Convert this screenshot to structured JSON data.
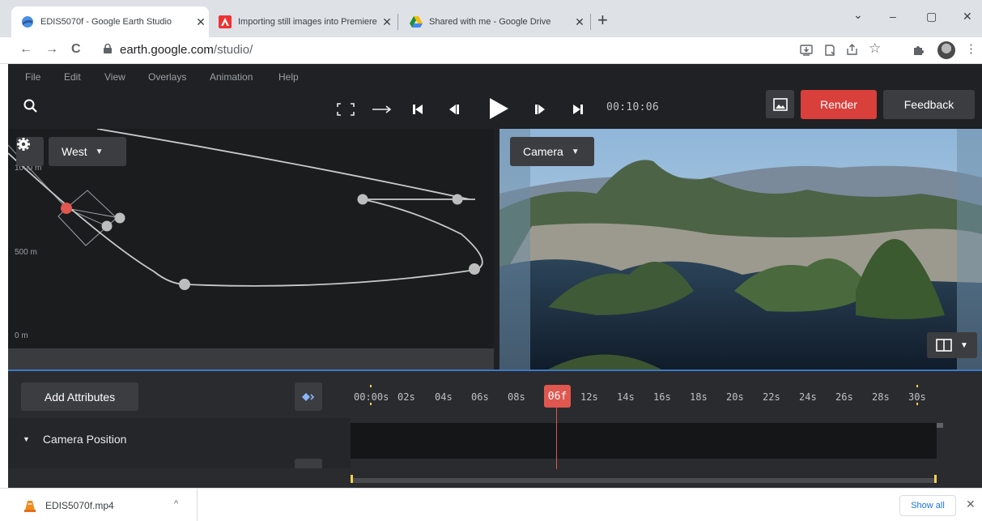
{
  "browser": {
    "tabs": [
      {
        "title": "EDIS5070f - Google Earth Studio",
        "close": "✕"
      },
      {
        "title": "Importing still images into Premiere",
        "close": "✕"
      },
      {
        "title": "Shared with me - Google Drive",
        "close": "✕"
      }
    ],
    "new_tab": "+",
    "window_controls": {
      "minimize": "–",
      "maximize": "▢",
      "close": "✕",
      "tab_search": "⌄"
    },
    "nav": {
      "back": "←",
      "forward": "→",
      "reload": "C"
    },
    "url_host": "earth.google.com",
    "url_path": "/studio/",
    "toolbar_icons": [
      "install-icon",
      "cast-icon",
      "share-icon",
      "bookmark-star-icon",
      "extensions-icon",
      "profile-avatar",
      "menu-dots-icon"
    ]
  },
  "app": {
    "menu": [
      "File",
      "Edit",
      "View",
      "Overlays",
      "Animation",
      "Help"
    ],
    "timecode": "00:10:06",
    "render_label": "Render",
    "feedback_label": "Feedback",
    "graph": {
      "view_dropdown": "West",
      "y_labels": [
        "1000 m",
        "500 m",
        "0 m"
      ]
    },
    "viewport": {
      "camera_dropdown": "Camera"
    },
    "timeline": {
      "add_attributes_label": "Add Attributes",
      "ticks": [
        "00:00s",
        "02s",
        "04s",
        "06s",
        "08s",
        "12s",
        "14s",
        "16s",
        "18s",
        "20s",
        "22s",
        "24s",
        "26s",
        "28s",
        "30s"
      ],
      "playhead_label": "06f",
      "track_label": "Camera Position"
    }
  },
  "downloads": {
    "file_name": "EDIS5070f.mp4",
    "caret": "^",
    "show_all": "Show all",
    "close": "✕"
  },
  "colors": {
    "render": "#d93f3b",
    "playhead": "#e0574f",
    "accent_blue": "#3b78c4",
    "marker_yellow": "#f2d24b"
  }
}
